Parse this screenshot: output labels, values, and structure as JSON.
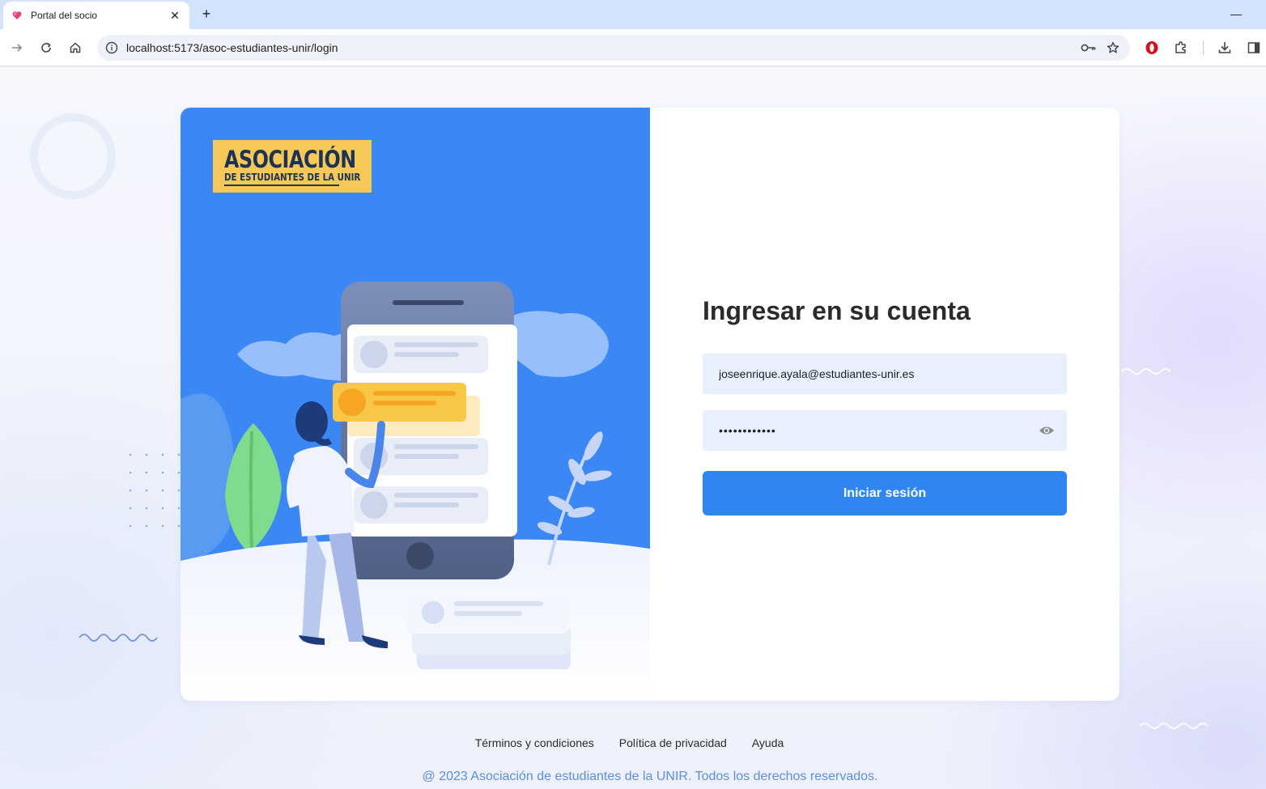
{
  "browser": {
    "tab_title": "Portal del socio",
    "url": "localhost:5173/asoc-estudiantes-unir/login"
  },
  "logo": {
    "title": "ASOCIACIÓN",
    "subtitle": "DE ESTUDIANTES DE LA UNIR"
  },
  "login": {
    "heading": "Ingresar en su cuenta",
    "email_value": "joseenrique.ayala@estudiantes-unir.es",
    "password_value": "••••••••••••",
    "submit_label": "Iniciar sesión"
  },
  "footer": {
    "links": [
      "Términos y condiciones",
      "Política de privacidad",
      "Ayuda"
    ],
    "copyright": "@ 2023 Asociación de estudiantes de la UNIR. Todos los derechos reservados."
  },
  "colors": {
    "primary": "#2f86f2",
    "hero_bg": "#3b88f5",
    "logo_bg": "#f6c857",
    "input_bg": "#e8f0fe"
  }
}
